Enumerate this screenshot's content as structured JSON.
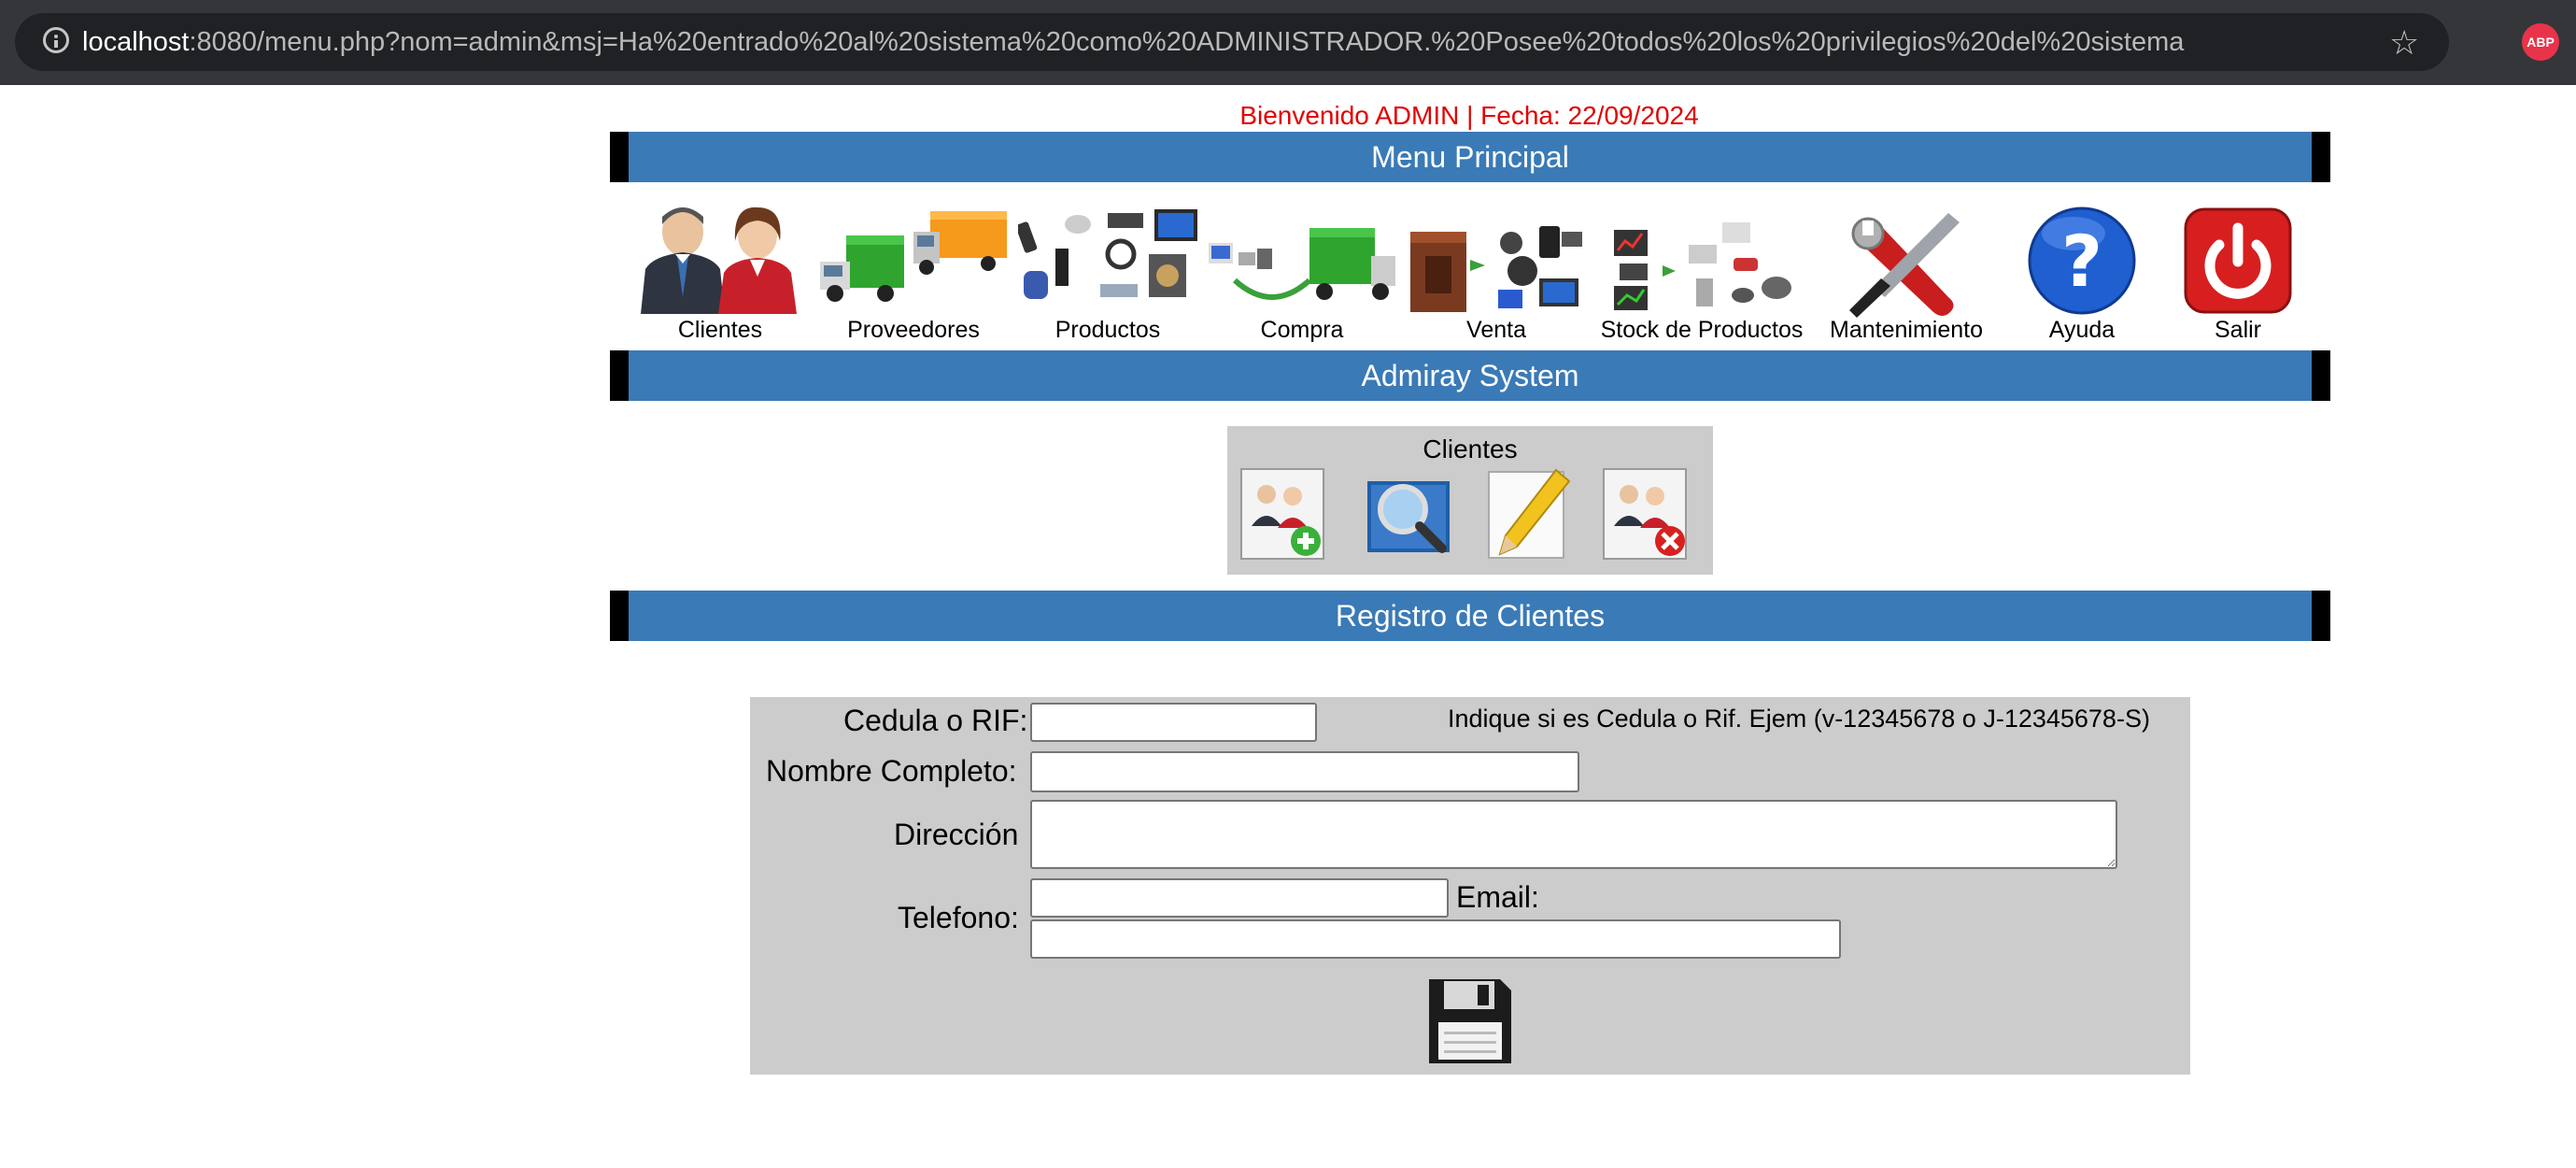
{
  "browser": {
    "url_host": "localhost",
    "url_rest": ":8080/menu.php?nom=admin&msj=Ha%20entrado%20al%20sistema%20como%20ADMINISTRADOR.%20Posee%20todos%20los%20privilegios%20del%20sistema",
    "extension_label": "ABP"
  },
  "welcome": "Bienvenido ADMIN | Fecha: 22/09/2024",
  "menu": {
    "title": "Menu Principal",
    "items": [
      {
        "label": "Clientes"
      },
      {
        "label": "Proveedores"
      },
      {
        "label": "Productos"
      },
      {
        "label": "Compra"
      },
      {
        "label": "Venta"
      },
      {
        "label": "Stock de Productos"
      },
      {
        "label": "Mantenimiento"
      },
      {
        "label": "Ayuda"
      },
      {
        "label": "Salir"
      }
    ]
  },
  "system_band": "Admiray System",
  "submenu": {
    "title": "Clientes",
    "actions": [
      "add-client-icon",
      "search-icon",
      "edit-icon",
      "delete-client-icon"
    ]
  },
  "form": {
    "title": "Registro de Clientes",
    "cedula_label": "Cedula o RIF:",
    "cedula_value": "",
    "cedula_hint": "Indique si es Cedula o Rif. Ejem (v-12345678 o J-12345678-S)",
    "nombre_label": "Nombre Completo:",
    "nombre_value": "",
    "direccion_label": "Dirección",
    "direccion_value": "",
    "telefono_label": "Telefono:",
    "telefono_value": "",
    "email_label": "Email:",
    "email_value": "",
    "save_icon": "floppy-disk-icon"
  },
  "colors": {
    "band": "#3a7ab6",
    "welcome": "#e00000",
    "panel": "#cccccc"
  }
}
